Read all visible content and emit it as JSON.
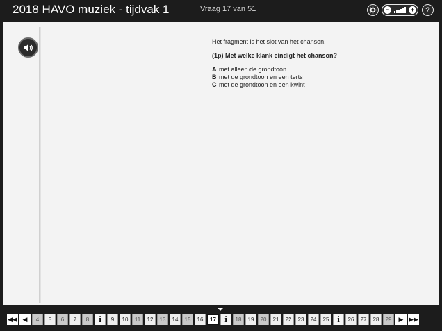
{
  "header": {
    "title": "2018 HAVO muziek - tijdvak 1",
    "counter": "Vraag 17 van 51",
    "settings_icon": "gear-icon",
    "help_label": "?"
  },
  "question": {
    "intro": "Het fragment is het slot van het chanson.",
    "text": "(1p) Met welke klank eindigt het chanson?",
    "options": [
      {
        "letter": "A",
        "text": "met alleen de grondtoon"
      },
      {
        "letter": "B",
        "text": "met de grondtoon en een terts"
      },
      {
        "letter": "C",
        "text": "met de grondtoon en een kwint"
      }
    ]
  },
  "nav": {
    "first_label": "◀◀",
    "prev_label": "◀",
    "next_label": "▶",
    "last_label": "▶▶",
    "items": [
      {
        "type": "num",
        "label": "4",
        "state": "gray"
      },
      {
        "type": "num",
        "label": "5",
        "state": "normal"
      },
      {
        "type": "num",
        "label": "6",
        "state": "gray"
      },
      {
        "type": "num",
        "label": "7",
        "state": "normal"
      },
      {
        "type": "num",
        "label": "8",
        "state": "gray"
      },
      {
        "type": "info",
        "label": "i",
        "state": "normal"
      },
      {
        "type": "num",
        "label": "9",
        "state": "normal"
      },
      {
        "type": "num",
        "label": "10",
        "state": "normal"
      },
      {
        "type": "num",
        "label": "11",
        "state": "gray"
      },
      {
        "type": "num",
        "label": "12",
        "state": "normal"
      },
      {
        "type": "num",
        "label": "13",
        "state": "gray"
      },
      {
        "type": "num",
        "label": "14",
        "state": "normal"
      },
      {
        "type": "num",
        "label": "15",
        "state": "gray"
      },
      {
        "type": "num",
        "label": "16",
        "state": "normal"
      },
      {
        "type": "num",
        "label": "17",
        "state": "cur"
      },
      {
        "type": "info",
        "label": "i",
        "state": "normal"
      },
      {
        "type": "num",
        "label": "18",
        "state": "gray"
      },
      {
        "type": "num",
        "label": "19",
        "state": "normal"
      },
      {
        "type": "num",
        "label": "20",
        "state": "gray"
      },
      {
        "type": "num",
        "label": "21",
        "state": "normal"
      },
      {
        "type": "num",
        "label": "22",
        "state": "normal"
      },
      {
        "type": "num",
        "label": "23",
        "state": "normal"
      },
      {
        "type": "num",
        "label": "24",
        "state": "normal"
      },
      {
        "type": "num",
        "label": "25",
        "state": "normal"
      },
      {
        "type": "info",
        "label": "i",
        "state": "normal"
      },
      {
        "type": "num",
        "label": "26",
        "state": "normal"
      },
      {
        "type": "num",
        "label": "27",
        "state": "normal"
      },
      {
        "type": "num",
        "label": "28",
        "state": "normal"
      },
      {
        "type": "num",
        "label": "29",
        "state": "gray"
      }
    ]
  }
}
